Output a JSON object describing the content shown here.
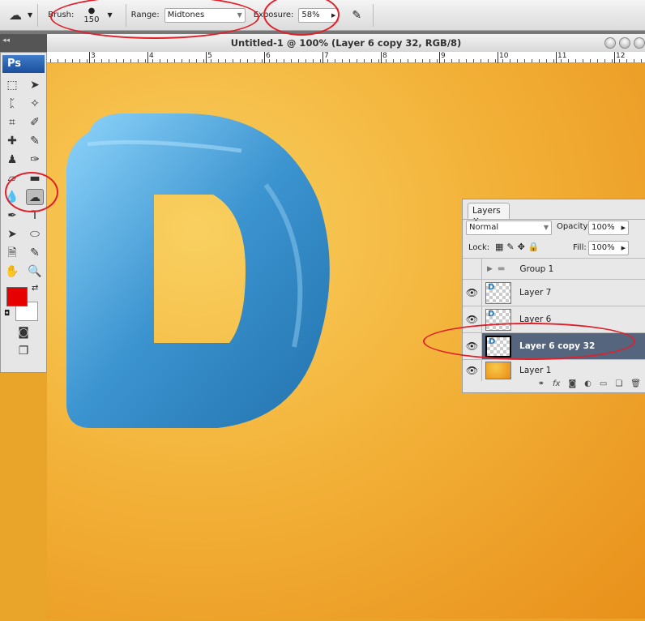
{
  "options_bar": {
    "brush_label": "Brush:",
    "brush_size": "150",
    "range_label": "Range:",
    "range_value": "Midtones",
    "exposure_label": "Exposure:",
    "exposure_value": "58%"
  },
  "document": {
    "title": "Untitled-1 @ 100% (Layer 6 copy 32, RGB/8)",
    "ruler_ticks": [
      "3",
      "4",
      "5",
      "6",
      "7",
      "8",
      "9",
      "10",
      "11",
      "12"
    ]
  },
  "toolbox": {
    "logo": "Ps",
    "foreground_color": "#e60000",
    "background_color": "#ffffff",
    "active_tool": "sponge-tool"
  },
  "layers_panel": {
    "tab": "Layers",
    "blend_mode": "Normal",
    "opacity_label": "Opacity:",
    "opacity": "100%",
    "lock_label": "Lock:",
    "fill_label": "Fill:",
    "fill": "100%",
    "layers": [
      {
        "name": "Group 1",
        "visible": false,
        "type": "group"
      },
      {
        "name": "Layer 7",
        "visible": true
      },
      {
        "name": "Layer 6",
        "visible": true
      },
      {
        "name": "Layer 6 copy 32",
        "visible": true,
        "selected": true
      },
      {
        "name": "Layer 1",
        "visible": true
      }
    ]
  },
  "colors": {
    "annotation": "#e0202a",
    "letter": "#3a8fcf",
    "selection": "#56657e"
  }
}
